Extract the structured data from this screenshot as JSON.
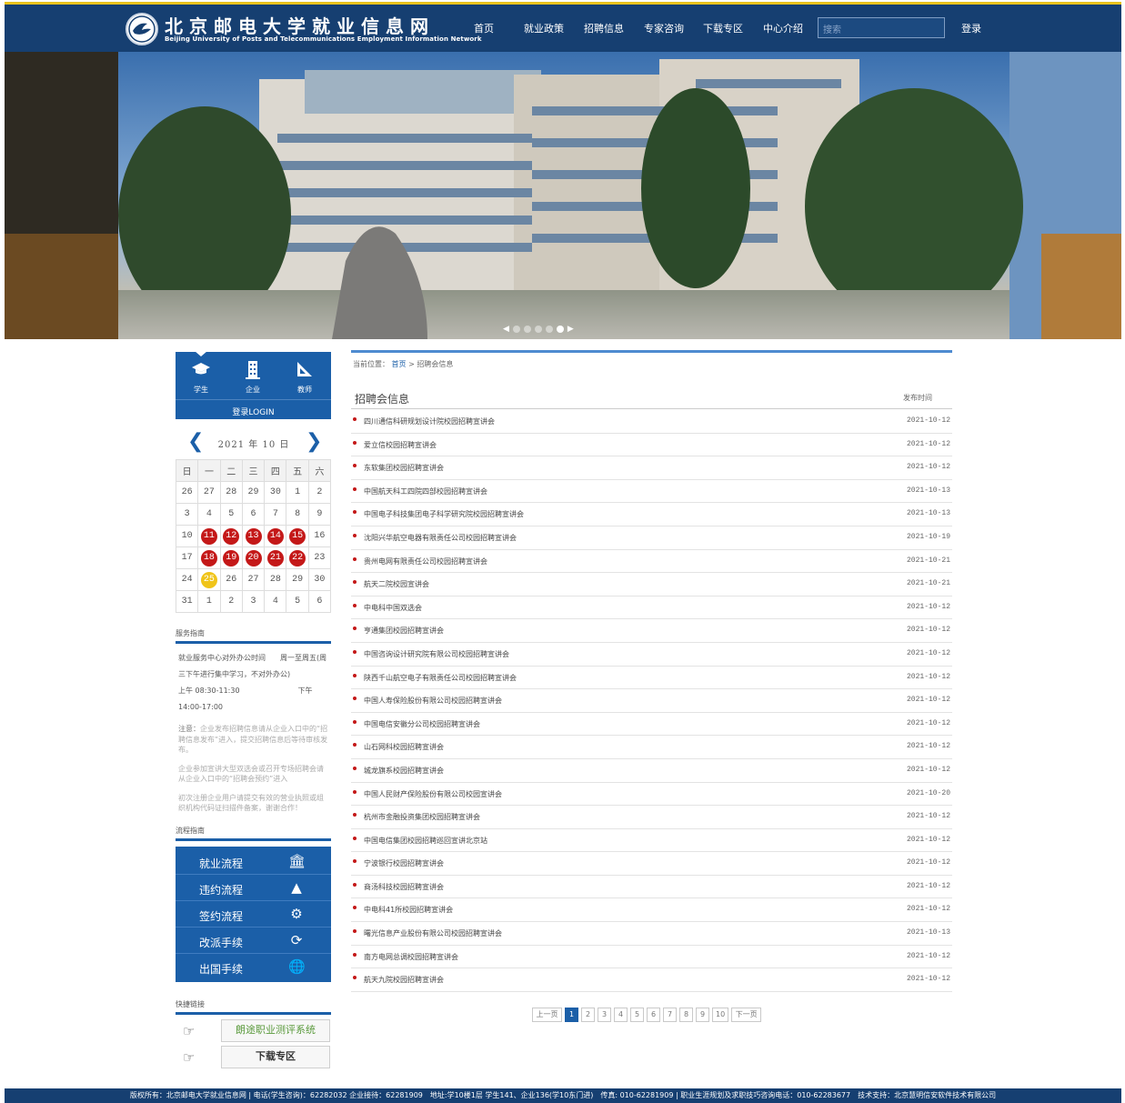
{
  "header": {
    "logo_cn": "北京邮电大学就业信息网",
    "logo_en": "Beijing University of Posts and Telecommunications Employment Information Network",
    "nav": [
      "首页",
      "就业政策",
      "招聘信息",
      "专家咨询",
      "下载专区",
      "中心介绍"
    ],
    "search_placeholder": "搜索",
    "login": "登录"
  },
  "banner": {
    "slide_count": 5,
    "active_slide": 4
  },
  "roles": {
    "items": [
      {
        "label": "学生",
        "icon": "graduation-cap-icon"
      },
      {
        "label": "企业",
        "icon": "building-icon"
      },
      {
        "label": "教师",
        "icon": "triangle-ruler-icon"
      }
    ],
    "login": "登录LOGIN"
  },
  "calendar": {
    "year": "2021",
    "year_unit": "年",
    "month": "10",
    "month_unit": "日",
    "weekdays": [
      "日",
      "一",
      "二",
      "三",
      "四",
      "五",
      "六"
    ],
    "rows": [
      [
        "26",
        "27",
        "28",
        "29",
        "30",
        "1",
        "2"
      ],
      [
        "3",
        "4",
        "5",
        "6",
        "7",
        "8",
        "9"
      ],
      [
        "10",
        "11",
        "12",
        "13",
        "14",
        "15",
        "16"
      ],
      [
        "17",
        "18",
        "19",
        "20",
        "21",
        "22",
        "23"
      ],
      [
        "24",
        "25",
        "26",
        "27",
        "28",
        "29",
        "30"
      ],
      [
        "31",
        "1",
        "2",
        "3",
        "4",
        "5",
        "6"
      ]
    ],
    "event_days": [
      "11",
      "12",
      "13",
      "14",
      "15",
      "18",
      "19",
      "20",
      "21",
      "22"
    ],
    "today": "25",
    "event_color": "#c41818",
    "today_color": "#f0c419"
  },
  "service": {
    "title": "服务指南",
    "line1": "就业服务中心对外办公时间　　周一至周五(周三下午进行集中学习，不对外办公)",
    "line2": "上午 08:30-11:30　　　　　　　　下午 14:00-17:00",
    "note1_label": "注意：",
    "note1": "企业发布招聘信息请从企业入口中的“招聘信息发布”进入，提交招聘信息后等待审核发布。",
    "note2": "企业参加宣讲大型双选会或召开专场招聘会请从企业入口中的“招聘会预约”进入",
    "note3": "初次注册企业用户请提交有效的营业执照或组织机构代码证扫描件备案，谢谢合作！"
  },
  "flow": {
    "title": "流程指南",
    "items": [
      {
        "label": "就业流程",
        "icon": "bank-icon"
      },
      {
        "label": "违约流程",
        "icon": "warning-icon"
      },
      {
        "label": "签约流程",
        "icon": "gears-icon"
      },
      {
        "label": "改派手续",
        "icon": "refresh-icon"
      },
      {
        "label": "出国手续",
        "icon": "globe-icon"
      }
    ]
  },
  "quick": {
    "title": "快捷链接",
    "links": [
      "朗途职业测评系统",
      "下载专区"
    ]
  },
  "breadcrumb": {
    "prefix": "当前位置：",
    "home": "首页",
    "sep": ">",
    "current": "招聘会信息"
  },
  "list": {
    "title": "招聘会信息",
    "date_header": "发布时间",
    "items": [
      {
        "name": "四川通信科研规划设计院校园招聘宣讲会",
        "date": "2021-10-12"
      },
      {
        "name": "爱立信校园招聘宣讲会",
        "date": "2021-10-12"
      },
      {
        "name": "东软集团校园招聘宣讲会",
        "date": "2021-10-12"
      },
      {
        "name": "中国航天科工四院四部校园招聘宣讲会",
        "date": "2021-10-13"
      },
      {
        "name": "中国电子科技集团电子科学研究院校园招聘宣讲会",
        "date": "2021-10-13"
      },
      {
        "name": "沈阳兴华航空电器有限责任公司校园招聘宣讲会",
        "date": "2021-10-19"
      },
      {
        "name": "贵州电网有限责任公司校园招聘宣讲会",
        "date": "2021-10-21"
      },
      {
        "name": "航天二院校园宣讲会",
        "date": "2021-10-21"
      },
      {
        "name": "中电科中国双选会",
        "date": "2021-10-12"
      },
      {
        "name": "亨通集团校园招聘宣讲会",
        "date": "2021-10-12"
      },
      {
        "name": "中国咨询设计研究院有限公司校园招聘宣讲会",
        "date": "2021-10-12"
      },
      {
        "name": "陕西千山航空电子有限责任公司校园招聘宣讲会",
        "date": "2021-10-12"
      },
      {
        "name": "中国人寿保险股份有限公司校园招聘宣讲会",
        "date": "2021-10-12"
      },
      {
        "name": "中国电信安徽分公司校园招聘宣讲会",
        "date": "2021-10-12"
      },
      {
        "name": "山石网科校园招聘宣讲会",
        "date": "2021-10-12"
      },
      {
        "name": "城龙旗系校园招聘宣讲会",
        "date": "2021-10-12"
      },
      {
        "name": "中国人民财产保险股份有限公司校园宣讲会",
        "date": "2021-10-20"
      },
      {
        "name": "杭州市金融投资集团校园招聘宣讲会",
        "date": "2021-10-12"
      },
      {
        "name": "中国电信集团校园招聘巡回宣讲北京站",
        "date": "2021-10-12"
      },
      {
        "name": "宁波银行校园招聘宣讲会",
        "date": "2021-10-12"
      },
      {
        "name": "商汤科技校园招聘宣讲会",
        "date": "2021-10-12"
      },
      {
        "name": "中电科41所校园招聘宣讲会",
        "date": "2021-10-12"
      },
      {
        "name": "曙光信息产业股份有限公司校园招聘宣讲会",
        "date": "2021-10-13"
      },
      {
        "name": "南方电网总调校园招聘宣讲会",
        "date": "2021-10-12"
      },
      {
        "name": "航天九院校园招聘宣讲会",
        "date": "2021-10-12"
      }
    ]
  },
  "pager": {
    "prev": "上一页",
    "next": "下一页",
    "pages": [
      "1",
      "2",
      "3",
      "4",
      "5",
      "6",
      "7",
      "8",
      "9",
      "10"
    ],
    "current": "1"
  },
  "footer": "版权所有：北京邮电大学就业信息网 | 电话(学生咨询)：62282032 企业接待：62281909　地址:学10楼1层 学生141、企业136(学10东门进)　传真: 010-62281909 | 职业生涯规划及求职技巧咨询电话：010-62283677　技术支持：北京慧明信安软件技术有限公司",
  "colors": {
    "header_bg": "#163f71",
    "accent": "#1b5fa8",
    "top_line": "#e8c21e"
  }
}
